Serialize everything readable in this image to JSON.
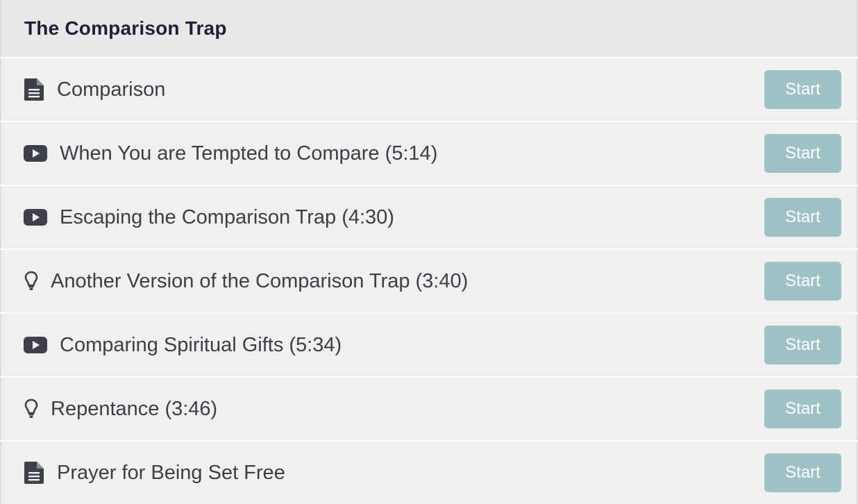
{
  "section": {
    "title": "The Comparison Trap"
  },
  "theme": {
    "button_bg": "#9ec2c5",
    "row_bg": "#f0f0f0",
    "header_bg": "#e8e8e8",
    "icon_color": "#3d4147"
  },
  "lessons": [
    {
      "icon": "document-icon",
      "title": "Comparison",
      "button_label": "Start"
    },
    {
      "icon": "video-icon",
      "title": "When You are Tempted to Compare (5:14)",
      "button_label": "Start"
    },
    {
      "icon": "video-icon",
      "title": "Escaping the Comparison Trap (4:30)",
      "button_label": "Start"
    },
    {
      "icon": "lightbulb-icon",
      "title": "Another Version of the Comparison Trap (3:40)",
      "button_label": "Start"
    },
    {
      "icon": "video-icon",
      "title": "Comparing Spiritual Gifts (5:34)",
      "button_label": "Start"
    },
    {
      "icon": "lightbulb-icon",
      "title": "Repentance (3:46)",
      "button_label": "Start"
    },
    {
      "icon": "document-icon",
      "title": "Prayer for Being Set Free",
      "button_label": "Start"
    }
  ]
}
